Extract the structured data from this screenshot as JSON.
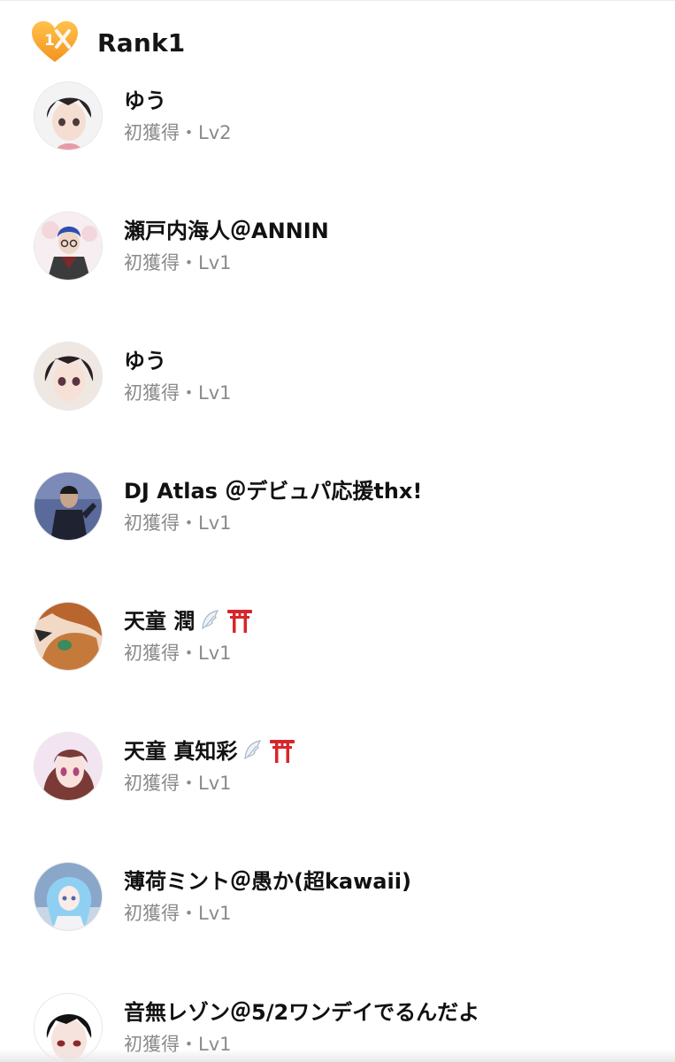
{
  "header": {
    "badge_number": "1",
    "title": "Rank1",
    "badge_color": "#F5A623"
  },
  "entries": [
    {
      "name": "ゆう",
      "acquisition": "初獲得",
      "separator": "・",
      "level": "Lv2",
      "emoji": []
    },
    {
      "name": "瀬戸内海人＠ANNIN",
      "acquisition": "初獲得",
      "separator": "・",
      "level": "Lv1",
      "emoji": []
    },
    {
      "name": "ゆう",
      "acquisition": "初獲得",
      "separator": "・",
      "level": "Lv1",
      "emoji": []
    },
    {
      "name": "DJ Atlas ＠デビュパ応援thx!",
      "acquisition": "初獲得",
      "separator": "・",
      "level": "Lv1",
      "emoji": []
    },
    {
      "name": "天童 潤",
      "acquisition": "初獲得",
      "separator": "・",
      "level": "Lv1",
      "emoji": [
        "wing-icon",
        "torii-icon"
      ]
    },
    {
      "name": "天童 真知彩",
      "acquisition": "初獲得",
      "separator": "・",
      "level": "Lv1",
      "emoji": [
        "wing-icon",
        "torii-icon"
      ]
    },
    {
      "name": "薄荷ミント＠愚か(超kawaii)",
      "acquisition": "初獲得",
      "separator": "・",
      "level": "Lv1",
      "emoji": []
    },
    {
      "name": "音無レゾン＠5/2ワンデイでるんだよ",
      "acquisition": "初獲得",
      "separator": "・",
      "level": "Lv1",
      "emoji": []
    }
  ],
  "colors": {
    "name_text": "#111111",
    "meta_text": "#8A8A8A",
    "torii_red": "#D7262B"
  }
}
